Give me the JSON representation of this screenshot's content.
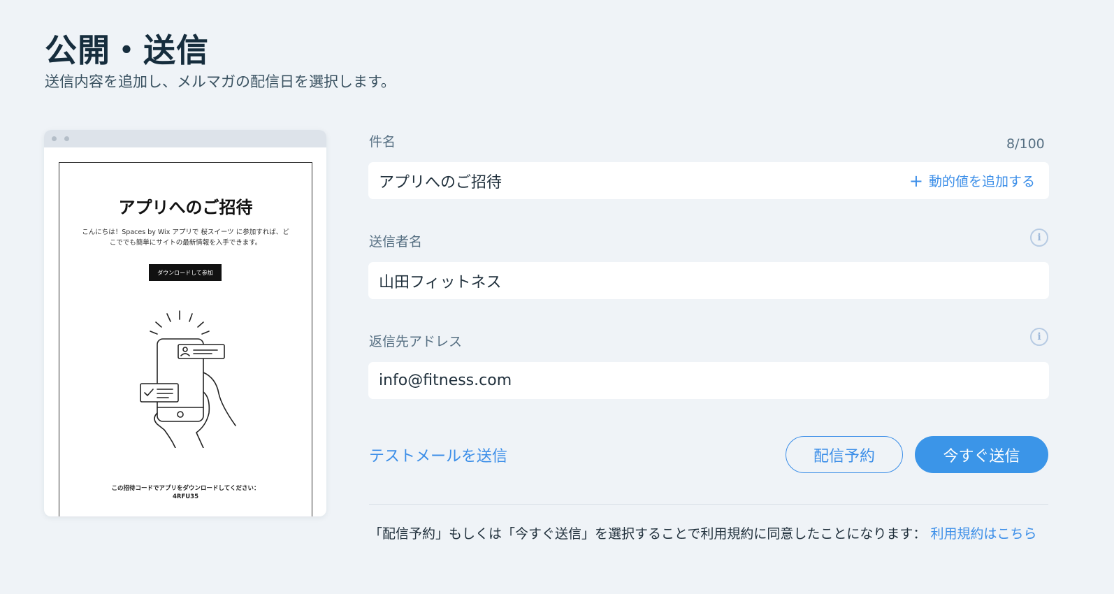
{
  "header": {
    "title": "公開・送信",
    "subtitle": "送信内容を追加し、メルマガの配信日を選択します。"
  },
  "preview": {
    "title": "アプリへのご招待",
    "body": "こんにちは！Spaces by Wix アプリで 桜スイーツ に参加すれば、どこででも簡単にサイトの最新情報を入手できます。",
    "button_label": "ダウンロードして参加",
    "footer_text": "この招待コードでアプリをダウンロードしてください：",
    "invite_code": "4RFU35"
  },
  "form": {
    "subject": {
      "label": "件名",
      "counter": "8/100",
      "value": "アプリへのご招待",
      "add_dynamic_label": "動的値を追加する"
    },
    "sender_name": {
      "label": "送信者名",
      "value": "山田フィットネス"
    },
    "reply_to": {
      "label": "返信先アドレス",
      "value": "info@fitness.com"
    }
  },
  "actions": {
    "test_email_label": "テストメールを送信",
    "schedule_label": "配信予約",
    "send_now_label": "今すぐ送信"
  },
  "terms": {
    "text": "「配信予約」もしくは「今すぐ送信」を選択することで利用規約に同意したことになります：",
    "link_text": "利用規約はこちら"
  },
  "colors": {
    "accent": "#3b8ee8",
    "background": "#eff3f7",
    "title": "#162d3d"
  }
}
